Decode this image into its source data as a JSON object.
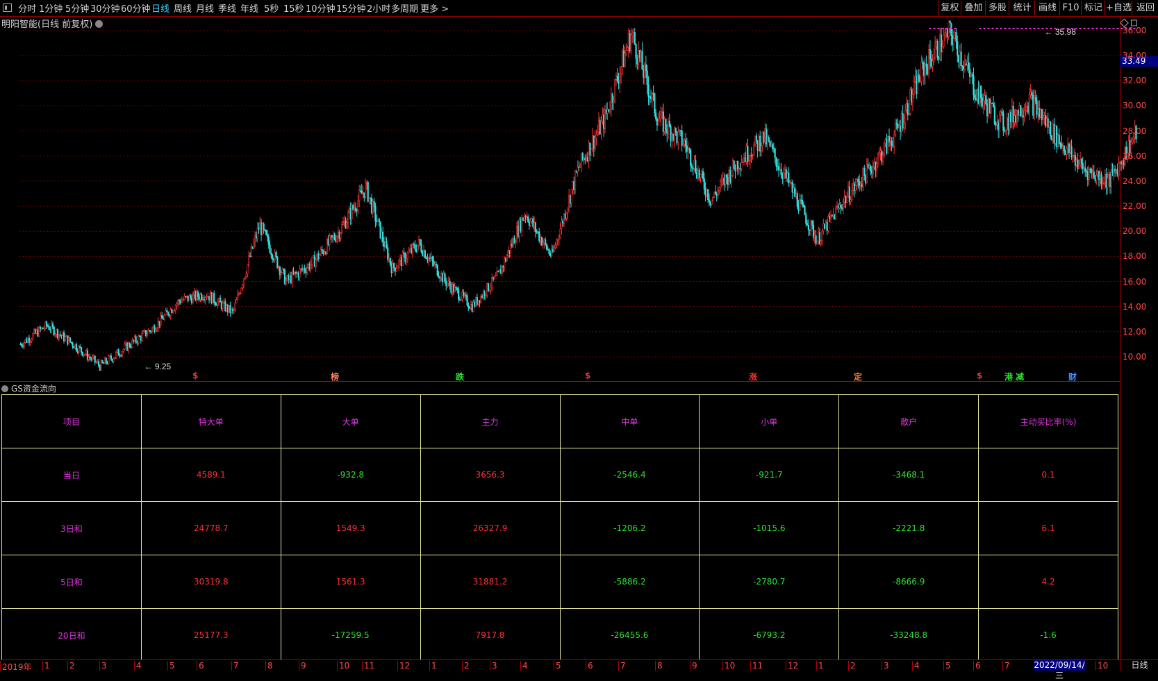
{
  "toolbar": {
    "periods": [
      "分时",
      "1分钟",
      "5分钟",
      "30分钟",
      "60分钟",
      "日线",
      "周线",
      "月线",
      "季线",
      "年线",
      "5秒",
      "15秒",
      "10分钟",
      "15分钟",
      "2小时",
      "多周期",
      "更多 >"
    ],
    "active_index": 5,
    "actions": [
      "复权",
      "叠加",
      "多股",
      "统计",
      "画线",
      "F10",
      "标记",
      "+自选",
      "返回"
    ]
  },
  "chart": {
    "title": "明阳智能(日线 前复权)",
    "axis_labels": [
      "36.00",
      "34.00",
      "32.00",
      "30.00",
      "28.00",
      "26.00",
      "24.00",
      "22.00",
      "20.00",
      "18.00",
      "16.00",
      "14.00",
      "12.00",
      "10.00"
    ],
    "current_price": "33.49",
    "high_label": "35.98",
    "low_label": "9.25",
    "events": [
      {
        "text": "$",
        "color": "#ff3030"
      },
      {
        "text": "榜",
        "color": "#ff8060"
      },
      {
        "text": "跌",
        "color": "#30e030"
      },
      {
        "text": "$",
        "color": "#ff3030"
      },
      {
        "text": "涨",
        "color": "#ff3030"
      },
      {
        "text": "定",
        "color": "#ff8030"
      },
      {
        "text": "$",
        "color": "#ff3030"
      },
      {
        "text": "港",
        "color": "#30e030"
      },
      {
        "text": "减",
        "color": "#30e030"
      },
      {
        "text": "财",
        "color": "#4a90ff"
      }
    ]
  },
  "chart_data": {
    "type": "candlestick",
    "title": "明阳智能(日线 前复权)",
    "ylim": [
      9,
      37
    ],
    "key_points": [
      {
        "x": "2019-01",
        "y": 11.0
      },
      {
        "x": "2019-02",
        "y": 12.5
      },
      {
        "x": "2019-03",
        "y": 11.0
      },
      {
        "x": "2019-04",
        "y": 9.25
      },
      {
        "x": "2019-05",
        "y": 10.8
      },
      {
        "x": "2019-06",
        "y": 12.3
      },
      {
        "x": "2019-07",
        "y": 14.5
      },
      {
        "x": "2019-08",
        "y": 15.0
      },
      {
        "x": "2019-09",
        "y": 13.5
      },
      {
        "x": "2019-10",
        "y": 20.5
      },
      {
        "x": "2019-11",
        "y": 16.0
      },
      {
        "x": "2019-12",
        "y": 17.5
      },
      {
        "x": "2020-01",
        "y": 20.0
      },
      {
        "x": "2020-02",
        "y": 23.5
      },
      {
        "x": "2020-03",
        "y": 17.0
      },
      {
        "x": "2020-04",
        "y": 19.0
      },
      {
        "x": "2020-05",
        "y": 16.0
      },
      {
        "x": "2020-06",
        "y": 14.0
      },
      {
        "x": "2020-07",
        "y": 16.5
      },
      {
        "x": "2020-08",
        "y": 21.5
      },
      {
        "x": "2020-09",
        "y": 18.0
      },
      {
        "x": "2020-10",
        "y": 25.0
      },
      {
        "x": "2020-11",
        "y": 29.0
      },
      {
        "x": "2020-12",
        "y": 35.8
      },
      {
        "x": "2021-01",
        "y": 29.0
      },
      {
        "x": "2021-02",
        "y": 27.0
      },
      {
        "x": "2021-03",
        "y": 22.5
      },
      {
        "x": "2021-04",
        "y": 25.5
      },
      {
        "x": "2021-05",
        "y": 27.5
      },
      {
        "x": "2021-06",
        "y": 23.5
      },
      {
        "x": "2021-07",
        "y": 19.3
      },
      {
        "x": "2021-08",
        "y": 22.5
      },
      {
        "x": "2021-09",
        "y": 25.0
      },
      {
        "x": "2021-10",
        "y": 28.0
      },
      {
        "x": "2021-11",
        "y": 33.0
      },
      {
        "x": "2021-12",
        "y": 35.98
      },
      {
        "x": "2022-01",
        "y": 31.0
      },
      {
        "x": "2022-02",
        "y": 28.5
      },
      {
        "x": "2022-03",
        "y": 30.5
      },
      {
        "x": "2022-04",
        "y": 27.5
      },
      {
        "x": "2022-05",
        "y": 25.0
      },
      {
        "x": "2022-06",
        "y": 24.0
      },
      {
        "x": "2022-09",
        "y": 27.8
      }
    ]
  },
  "panel": {
    "title": "GS资金流向",
    "headers": [
      "项目",
      "特大单",
      "大单",
      "主力",
      "中单",
      "小单",
      "散户",
      "主动买比率(%)"
    ],
    "rows": [
      {
        "label": "当日",
        "values": [
          "4589.1",
          "-932.8",
          "3656.3",
          "-2546.4",
          "-921.7",
          "-3468.1",
          "0.1"
        ]
      },
      {
        "label": "3日和",
        "values": [
          "24778.7",
          "1549.3",
          "26327.9",
          "-1206.2",
          "-1015.6",
          "-2221.8",
          "6.1"
        ]
      },
      {
        "label": "5日和",
        "values": [
          "30319.8",
          "1561.3",
          "31881.2",
          "-5886.2",
          "-2780.7",
          "-8666.9",
          "4.2"
        ]
      },
      {
        "label": "20日和",
        "values": [
          "25177.3",
          "-17259.5",
          "7917.8",
          "-26455.6",
          "-6793.2",
          "-33248.8",
          "-1.6"
        ]
      }
    ]
  },
  "bottom": {
    "ticks": [
      "2019年",
      "1",
      "2",
      "3",
      "4",
      "5",
      "6",
      "7",
      "8",
      "9",
      "10",
      "11",
      "12",
      "1",
      "2",
      "3",
      "4",
      "5",
      "6",
      "7",
      "8",
      "9",
      "10",
      "11",
      "12",
      "1",
      "2",
      "3",
      "4",
      "5",
      "6",
      "7",
      "8",
      "9",
      "10"
    ],
    "current_date": "2022/09/14/三",
    "period": "日线"
  },
  "colors": {
    "up": "#ff3030",
    "down": "#30e0e0",
    "grid": "#7a0000",
    "magenta": "#e033e0"
  }
}
